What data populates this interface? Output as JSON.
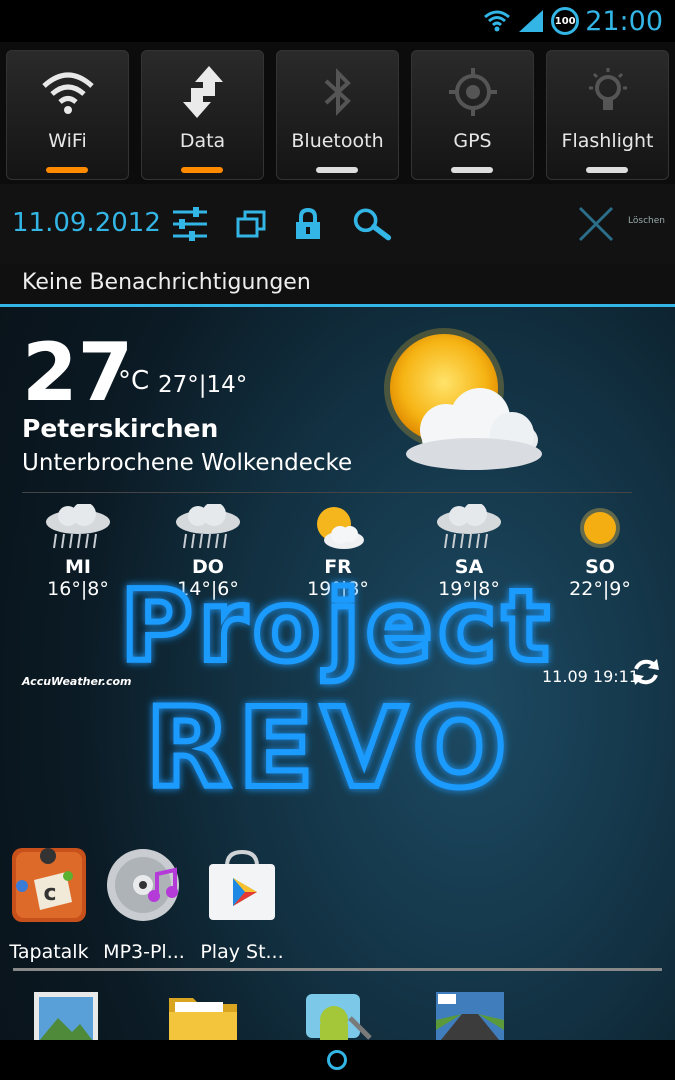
{
  "status_bar": {
    "time": "21:00",
    "battery": "100"
  },
  "toggles": [
    {
      "label": "WiFi",
      "icon": "wifi-icon",
      "state": "on",
      "indicator_color": "#ff8a00"
    },
    {
      "label": "Data",
      "icon": "data-arrows-icon",
      "state": "on",
      "indicator_color": "#ff8a00"
    },
    {
      "label": "Bluetooth",
      "icon": "bluetooth-icon",
      "state": "off",
      "indicator_color": "#dddddd"
    },
    {
      "label": "GPS",
      "icon": "gps-icon",
      "state": "off",
      "indicator_color": "#dddddd"
    },
    {
      "label": "Flashlight",
      "icon": "flashlight-icon",
      "state": "off",
      "indicator_color": "#dddddd"
    }
  ],
  "toolbar": {
    "date": "11.09.2012",
    "clear_label": "Löschen"
  },
  "notifications": {
    "empty_label": "Keine Benachrichtigungen"
  },
  "weather": {
    "temperature": "27",
    "unit": "°C",
    "hi_lo": "27°|14°",
    "location": "Peterskirchen",
    "condition": "Unterbrochene Wolkendecke",
    "forecast": [
      {
        "day": "MI",
        "temps": "16°|8°",
        "icon": "rain-cloud-icon"
      },
      {
        "day": "DO",
        "temps": "14°|6°",
        "icon": "rain-cloud-icon"
      },
      {
        "day": "FR",
        "temps": "19°|8°",
        "icon": "sun-cloud-icon"
      },
      {
        "day": "SA",
        "temps": "19°|8°",
        "icon": "rain-cloud-icon"
      },
      {
        "day": "SO",
        "temps": "22°|9°",
        "icon": "sun-icon"
      }
    ],
    "provider": "AccuWeather.com",
    "updated": "11.09 19:11"
  },
  "overlay": {
    "line1": "Project",
    "line2": "REVO"
  },
  "apps": [
    {
      "label": "Tapatalk",
      "icon": "tapatalk-icon"
    },
    {
      "label": "MP3-Pl...",
      "icon": "mp3-player-icon"
    },
    {
      "label": "Play St...",
      "icon": "play-store-icon"
    }
  ],
  "dock": [
    "gallery-icon",
    "file-manager-icon",
    "android-app-icon",
    "racing-game-icon"
  ],
  "colors": {
    "accent": "#33b5e5",
    "toggle_on": "#ff8a00",
    "overlay_glow": "#1e9bff"
  }
}
